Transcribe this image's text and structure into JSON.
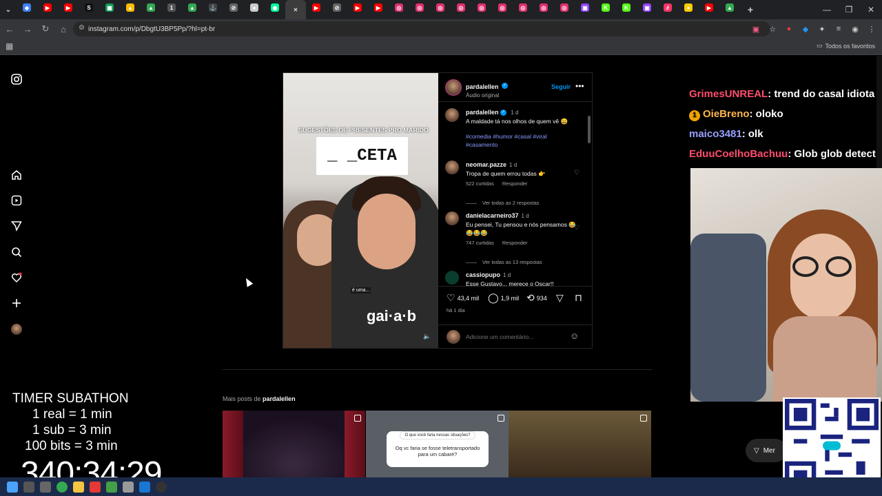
{
  "browser": {
    "url": "instagram.com/p/DbgtU3BP5Pp/?hl=pt-br",
    "bookmarks_label": "Todos os favoritos",
    "tabs": [
      {
        "icon": "world",
        "color": "#3b82f6",
        "g": "◆"
      },
      {
        "icon": "youtube",
        "color": "#ff0000",
        "g": "▶"
      },
      {
        "icon": "youtube",
        "color": "#ff0000",
        "g": "▶"
      },
      {
        "icon": "s",
        "color": "#111",
        "g": "S"
      },
      {
        "icon": "sheets",
        "color": "#0f9d58",
        "g": "▦"
      },
      {
        "icon": "drive",
        "color": "#fbbc04",
        "g": "▲"
      },
      {
        "icon": "drive",
        "color": "#34a853",
        "g": "▲"
      },
      {
        "icon": "tab",
        "color": "#555",
        "g": "1"
      },
      {
        "icon": "drive",
        "color": "#34a853",
        "g": "▲"
      },
      {
        "icon": "anchor",
        "color": "#444",
        "g": "⚓"
      },
      {
        "icon": "link",
        "color": "#666",
        "g": "⊘"
      },
      {
        "icon": "circle",
        "color": "#ccc",
        "g": "●"
      },
      {
        "icon": "eye",
        "color": "#0f9",
        "g": "◉"
      },
      {
        "icon": "instagram",
        "color": "#333",
        "g": "✕"
      },
      {
        "icon": "youtube",
        "color": "#ff0000",
        "g": "▶"
      },
      {
        "icon": "link",
        "color": "#666",
        "g": "⊘"
      },
      {
        "icon": "youtube",
        "color": "#ff0000",
        "g": "▶"
      },
      {
        "icon": "youtube",
        "color": "#ff0000",
        "g": "▶"
      },
      {
        "icon": "instagram",
        "color": "#e1306c",
        "g": "◎"
      },
      {
        "icon": "instagram",
        "color": "#e1306c",
        "g": "◎"
      },
      {
        "icon": "instagram",
        "color": "#e1306c",
        "g": "◎"
      },
      {
        "icon": "instagram",
        "color": "#e1306c",
        "g": "◎"
      },
      {
        "icon": "instagram",
        "color": "#e1306c",
        "g": "◎"
      },
      {
        "icon": "instagram",
        "color": "#e1306c",
        "g": "◎"
      },
      {
        "icon": "instagram",
        "color": "#e1306c",
        "g": "◎"
      },
      {
        "icon": "instagram",
        "color": "#e1306c",
        "g": "◎"
      },
      {
        "icon": "instagram",
        "color": "#e1306c",
        "g": "◎"
      },
      {
        "icon": "twitch",
        "color": "#9146ff",
        "g": "▣"
      },
      {
        "icon": "kick",
        "color": "#53fc18",
        "g": "K"
      },
      {
        "icon": "kick",
        "color": "#53fc18",
        "g": "K"
      },
      {
        "icon": "twitch",
        "color": "#9146ff",
        "g": "▣"
      },
      {
        "icon": "other",
        "color": "#ff3366",
        "g": "∂"
      },
      {
        "icon": "other",
        "color": "#ffcc00",
        "g": "●"
      },
      {
        "icon": "youtube",
        "color": "#ff0000",
        "g": "▶"
      },
      {
        "icon": "drive",
        "color": "#34a853",
        "g": "▲"
      }
    ]
  },
  "post": {
    "author": "pardalellen",
    "audio": "Áudio original",
    "follow": "Seguir",
    "more": "•••",
    "video": {
      "caption": "SUGESTÕES DE PRESENTES PRO MARIDO",
      "card": "_ _CETA",
      "subtitle": "é uma...",
      "shirt": "gai·a·b"
    },
    "caption": {
      "user": "pardalellen",
      "ago": "1 d",
      "text": "A maldade tá nos olhos de quem vê 😄",
      "tags": "#comedia #humor #casal #viral #casamento"
    },
    "comments": [
      {
        "user": "neomar.pazze",
        "ago": "1 d",
        "text": "Tropa de quem errou todas 👉",
        "likes": "522 curtidas",
        "reply": "Responder",
        "replies": "Ver todas as 2 respostas"
      },
      {
        "user": "danielacarneiro37",
        "ago": "1 d",
        "text": "Eu pensei, Tu pensou e nós pensamos 😂😂😂😂",
        "likes": "747 curtidas",
        "reply": "Responder",
        "replies": "Ver todas as 13 respostas"
      },
      {
        "user": "cassiopupo",
        "ago": "1 d",
        "text": "Esse Gustavo... merece o Oscar!!"
      }
    ],
    "likes": "43,4 mil",
    "comment_count": "1,9 mil",
    "shares": "934",
    "posted": "há 1 dia",
    "add_comment_placeholder": "Adicione um comentário..."
  },
  "more_posts": {
    "label": "Mais posts de",
    "user": "pardalellen",
    "thumb2_question": "O que você faria nessas situações?",
    "thumb2_text": "Oq vc faria se fosse teletransportado para um cabaré?"
  },
  "messages_label": "Mer",
  "stream": {
    "chat": [
      {
        "user": "GrimesUNREAL",
        "color": "#ff4d6d",
        "msg": ": trend do casal idiota"
      },
      {
        "user": "OieBreno",
        "color": "#ffb74d",
        "msg": ": oloko",
        "badge": "1"
      },
      {
        "user": "maico3481",
        "color": "#9aa0ff",
        "msg": ": olk"
      },
      {
        "user": "EduuCoelhoBachuu",
        "color": "#ff4d6d",
        "msg": ": Glob glob detect"
      }
    ],
    "timer": {
      "title": "TIMER SUBATHON",
      "line1": "1 real = 1 min",
      "line2": "1 sub = 3 min",
      "line3": "100 bits = 3 min",
      "clock": "340:34:29"
    }
  }
}
